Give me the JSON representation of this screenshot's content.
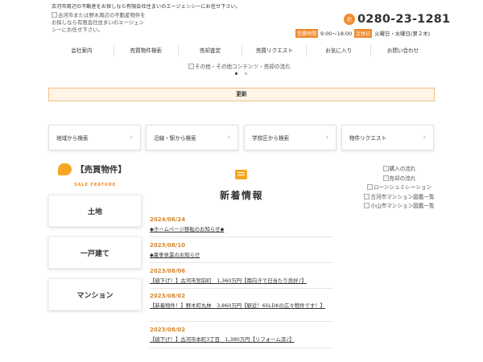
{
  "header": {
    "tagline": "古河市周辺の不動産をお探しなら有限会社住まいのエージェンシーにお任せ下さい。",
    "logo_alt": "古河市または野木周辺の不動産物件をお探しなら有限会社住まいのエージェンシーにお任せ下さい。",
    "phone": "0280-23-1281",
    "hours_badge": "営業時間",
    "hours": "9:00～18:00",
    "closed_badge": "定休日",
    "closed": "火曜日・水曜日(第２木)"
  },
  "nav": [
    {
      "label": "会社案内"
    },
    {
      "label": "売買物件検索"
    },
    {
      "label": "売却査定"
    },
    {
      "label": "売買リクエスト"
    },
    {
      "label": "お気に入り"
    },
    {
      "label": "お問い合わせ"
    }
  ],
  "slider": {
    "alt": "その他・その他コンテンツ・売却の流れ"
  },
  "update": {
    "label": "更新"
  },
  "search_buttons": [
    {
      "label": "地域から検索"
    },
    {
      "label": "沿線・駅から検索"
    },
    {
      "label": "学校区から検索"
    },
    {
      "label": "物件リクエスト"
    }
  ],
  "sidebar": {
    "title": "【売買物件】",
    "subtitle": "SALE FEATURE",
    "categories": [
      {
        "label": "土地"
      },
      {
        "label": "一戸建て"
      },
      {
        "label": "マンション"
      }
    ]
  },
  "news": {
    "title": "新着情報",
    "items": [
      {
        "date": "2024/06/24",
        "text": "◆ホームページ移転のお知らせ◆"
      },
      {
        "date": "2023/08/10",
        "text": "◆夏季休業のお知らせ"
      },
      {
        "date": "2023/08/06",
        "text": "【値下げ！】古河市宮前町　1,360万円【南向きで日当たり良好♪】"
      },
      {
        "date": "2023/08/02",
        "text": "【新着物件！】野木町丸林　3,860万円【駅近！6SLDKの広々物件です！】"
      },
      {
        "date": "2023/08/02",
        "text": "【値下げ！】古河市本町3丁目　1,380万円【リフォーム済♪】"
      }
    ]
  },
  "right_links": [
    {
      "label": "購入の流れ"
    },
    {
      "label": "売却の流れ"
    },
    {
      "label": "ローンシュミレーション"
    },
    {
      "label": "古河市マンション図鑑一覧"
    },
    {
      "label": "小山市マンション図鑑一覧"
    }
  ],
  "colors": {
    "accent": "#f08c2c",
    "date": "#d4862e",
    "update_bg": "#fff4e6"
  },
  "icons": {
    "phone": "phone-icon",
    "chevron": "chevron-right-icon",
    "bubble": "speech-bubble-icon",
    "news": "news-icon"
  }
}
